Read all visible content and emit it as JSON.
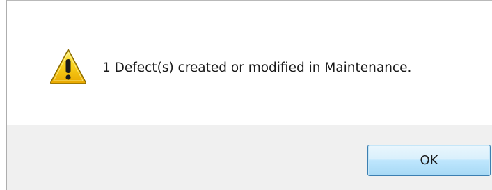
{
  "dialog": {
    "icon": "warning-icon",
    "message": "1 Defect(s) created or modified in Maintenance.",
    "ok_label": "OK"
  },
  "colors": {
    "warning_yellow": "#f5c400",
    "button_border": "#3c7fb1",
    "footer_bg": "#f0f0f0"
  }
}
